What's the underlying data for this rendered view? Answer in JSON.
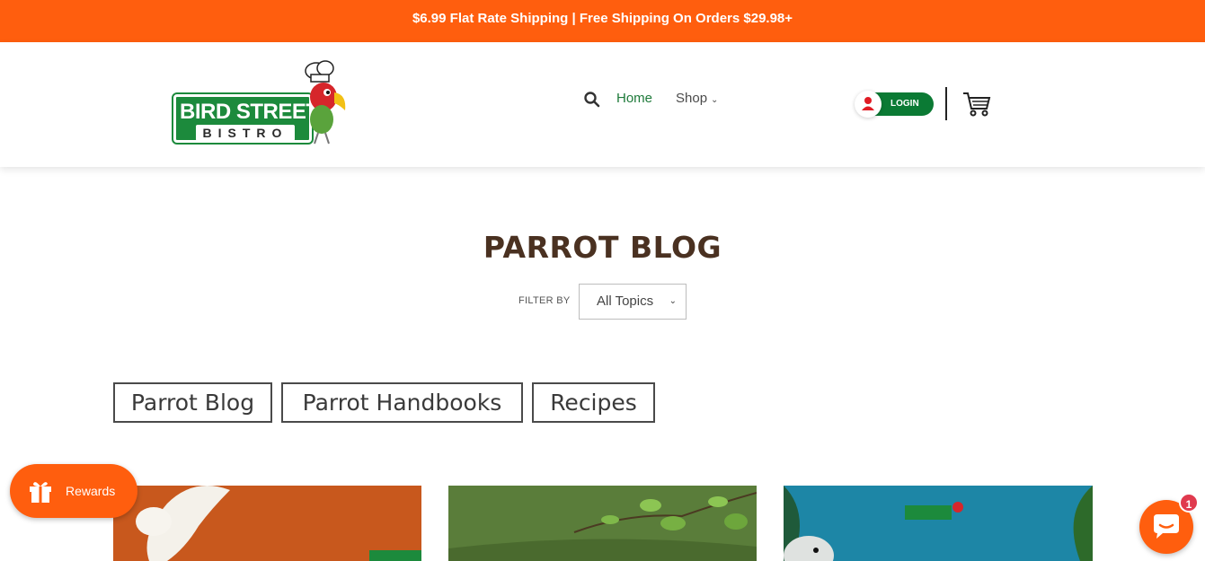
{
  "announcement": "$6.99 Flat Rate Shipping | Free Shipping On Orders $29.98+",
  "logo": {
    "line1": "BIRD STREET",
    "line2": "BISTRO",
    "icon": "parrot-chef-logo"
  },
  "nav": {
    "search_icon": "search-icon",
    "items": [
      {
        "label": "Home",
        "active": true
      },
      {
        "label": "Shop",
        "has_dropdown": true
      }
    ],
    "login_label": "LOGIN",
    "cart_icon": "cart-icon"
  },
  "page": {
    "title": "PARROT BLOG",
    "filter_label": "FILTER BY",
    "filter_value": "All Topics"
  },
  "categories": [
    "Parrot Blog",
    "Parrot Handbooks",
    "Recipes"
  ],
  "cards": [
    {
      "theme": "orange cockatoo",
      "color": "#c8581d"
    },
    {
      "theme": "green leaves",
      "color": "#557c35"
    },
    {
      "theme": "blue parrot",
      "color": "#1d86a6"
    }
  ],
  "rewards": {
    "label": "Rewards",
    "icon": "gift-icon"
  },
  "chat": {
    "icon": "chat-bubble-icon",
    "badge": "1"
  },
  "colors": {
    "accent": "#ff5e0e",
    "brand_green": "#1c8a3c",
    "title_brown": "#4a3121"
  }
}
